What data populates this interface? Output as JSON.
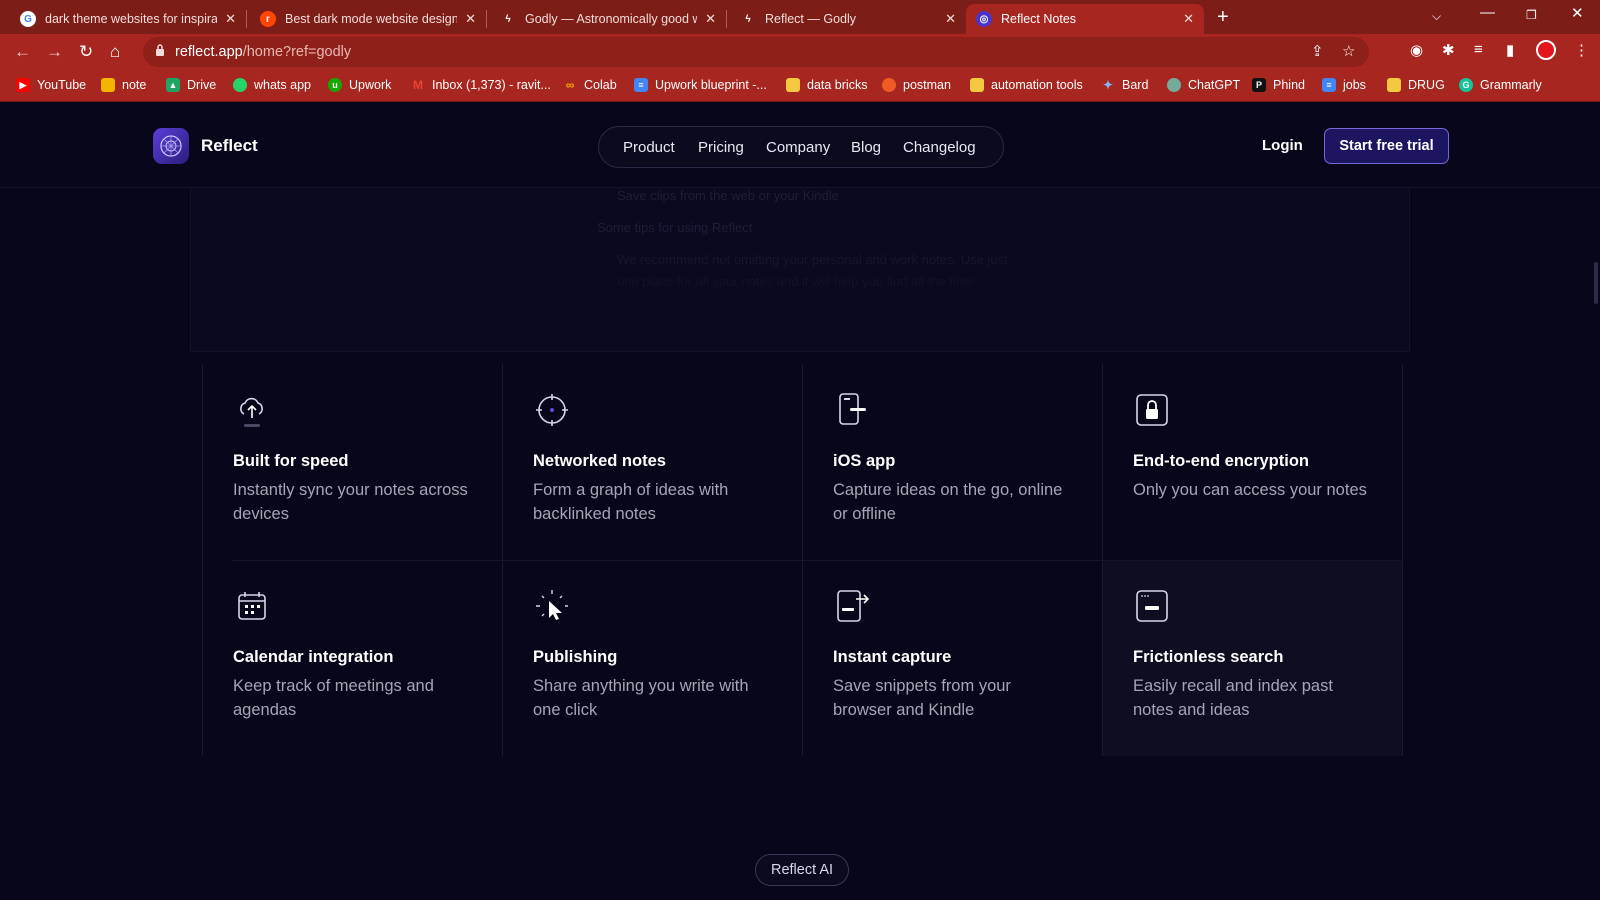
{
  "browser": {
    "tabs": [
      {
        "title": "dark theme websites for inspirati",
        "favicon": "google-icon",
        "active": false
      },
      {
        "title": "Best dark mode website designs?",
        "favicon": "reddit-icon",
        "active": false
      },
      {
        "title": "Godly — Astronomically good w",
        "favicon": "godly-icon",
        "active": false
      },
      {
        "title": "Reflect — Godly",
        "favicon": "godly-icon",
        "active": false
      },
      {
        "title": "Reflect Notes",
        "favicon": "reflect-icon",
        "active": true
      }
    ],
    "url_host": "reflect.app",
    "url_path": "/home?ref=godly",
    "bookmarks": [
      {
        "label": "YouTube",
        "icon": "youtube-icon",
        "color": "#ff0000"
      },
      {
        "label": "note",
        "icon": "note-icon",
        "color": "#f5b400"
      },
      {
        "label": "Drive",
        "icon": "drive-icon",
        "color": "#1fa463"
      },
      {
        "label": "whats app",
        "icon": "whatsapp-icon",
        "color": "#25d366"
      },
      {
        "label": "Upwork",
        "icon": "upwork-icon",
        "color": "#14a800"
      },
      {
        "label": "Inbox (1,373) - ravit...",
        "icon": "gmail-icon",
        "color": "#ea4335"
      },
      {
        "label": "Colab",
        "icon": "colab-icon",
        "color": "#f9ab00"
      },
      {
        "label": "Upwork blueprint -...",
        "icon": "docs-icon",
        "color": "#4285f4"
      },
      {
        "label": "data bricks",
        "icon": "folder-icon",
        "color": "#f5c842"
      },
      {
        "label": "postman",
        "icon": "postman-icon",
        "color": "#ef5b25"
      },
      {
        "label": "automation tools",
        "icon": "folder-icon",
        "color": "#f5c842"
      },
      {
        "label": "Bard",
        "icon": "bard-icon",
        "color": "#8ab4f8"
      },
      {
        "label": "ChatGPT",
        "icon": "chatgpt-icon",
        "color": "#74aa9c"
      },
      {
        "label": "Phind",
        "icon": "phind-icon",
        "color": "#111111"
      },
      {
        "label": "jobs",
        "icon": "docs-icon",
        "color": "#4285f4"
      },
      {
        "label": "DRUG",
        "icon": "folder-icon",
        "color": "#f5c842"
      },
      {
        "label": "Grammarly",
        "icon": "grammarly-icon",
        "color": "#15c39a"
      }
    ]
  },
  "site": {
    "brand": "Reflect",
    "nav": [
      "Product",
      "Pricing",
      "Company",
      "Blog",
      "Changelog"
    ],
    "login": "Login",
    "cta": "Start free trial",
    "ghost_lines": [
      "Save clips from the web or your Kindle",
      "Some tips for using Reflect",
      "We recommend not omitting your personal and work notes. Use just",
      "one place for all your notes and it will help you find all the time"
    ],
    "features": [
      {
        "title": "Built for speed",
        "desc": "Instantly sync your notes across devices",
        "icon": "cloud-upload-icon"
      },
      {
        "title": "Networked notes",
        "desc": "Form a graph of ideas with backlinked notes",
        "icon": "network-node-icon"
      },
      {
        "title": "iOS app",
        "desc": "Capture ideas on the go, online or offline",
        "icon": "phone-icon"
      },
      {
        "title": "End-to-end encryption",
        "desc": "Only you can access your notes",
        "icon": "lock-icon"
      },
      {
        "title": "Calendar integration",
        "desc": "Keep track of meetings and agendas",
        "icon": "calendar-icon"
      },
      {
        "title": "Publishing",
        "desc": "Share anything you write with one click",
        "icon": "cursor-sparkle-icon"
      },
      {
        "title": "Instant capture",
        "desc": "Save snippets from your browser and Kindle",
        "icon": "capture-icon"
      },
      {
        "title": "Frictionless search",
        "desc": "Easily recall and index past notes and ideas",
        "icon": "search-window-icon"
      }
    ],
    "ai_badge": "Reflect AI"
  }
}
